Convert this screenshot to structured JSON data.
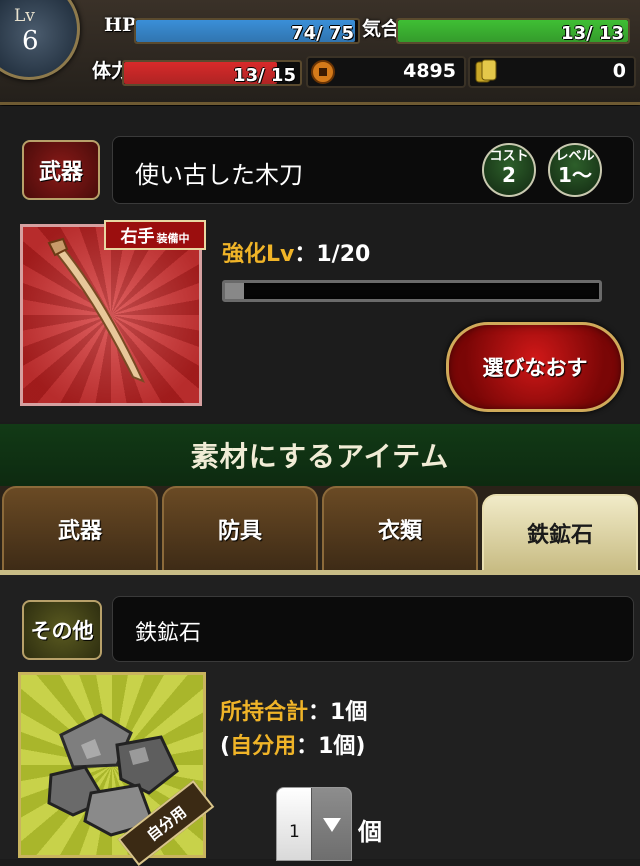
{
  "status": {
    "level_label": "Lv",
    "level_value": "6",
    "hp_label": "HP",
    "hp_text": "74/ 75",
    "hp_fraction": 0.987,
    "spirit_label": "気合",
    "spirit_text": "13/ 13",
    "spirit_fraction": 1.0,
    "stamina_label": "体力",
    "stamina_text": "13/ 15",
    "stamina_fraction": 0.867,
    "coins": "4895",
    "gold": "0",
    "colors": {
      "hp": "#3a8fd8",
      "spirit": "#3fbf34",
      "stamina": "#d82a2a"
    }
  },
  "weapon": {
    "category": "武器",
    "name": "使い古した木刀",
    "cost_label": "コスト",
    "cost_value": "2",
    "level_req_label": "レベル",
    "level_req_value": "1〜",
    "equip_hand": "右手",
    "equip_status": "装備中",
    "enhance_label": "強化Lv",
    "enhance_value": "：1/20",
    "enhance_fraction": 0.05,
    "reselect_label": "選びなおす"
  },
  "material": {
    "header": "素材にするアイテム",
    "tabs": [
      {
        "label": "武器",
        "active": false
      },
      {
        "label": "防具",
        "active": false
      },
      {
        "label": "衣類",
        "active": false
      },
      {
        "label": "鉄鉱石",
        "active": true
      }
    ],
    "category": "その他",
    "item_name": "鉄鉱石",
    "total_label": "所持合計",
    "total_value": "：1個",
    "own_open": "(",
    "own_label": "自分用",
    "own_value": "：1個)",
    "self_use_tag": "自分用",
    "quantity": "1",
    "quantity_unit": "個"
  }
}
